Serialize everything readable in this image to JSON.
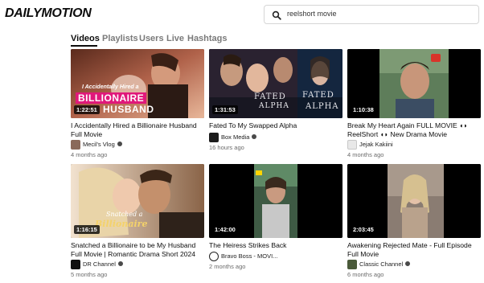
{
  "brand": {
    "logo": "DAILYMOTION"
  },
  "search": {
    "query": "reelshort movie"
  },
  "tabs": [
    {
      "label": "Videos",
      "active": true
    },
    {
      "label": "Playlists",
      "active": false
    },
    {
      "label": "Users",
      "active": false
    },
    {
      "label": "Live",
      "active": false
    },
    {
      "label": "Hashtags",
      "active": false
    }
  ],
  "videos": [
    {
      "title": "I Accidentally Hired a Billionaire Husband Full Movie",
      "duration": "1:22:51",
      "channel": "Mecil's Vlog",
      "age": "4 months ago",
      "thumb_text_1": "I Accidentally Hired a",
      "thumb_text_2": "BILLIONAIRE",
      "thumb_text_3": "HUSBAND"
    },
    {
      "title": "Fated To My Swapped Alpha",
      "duration": "1:31:53",
      "channel": "Box Media",
      "age": "16 hours ago",
      "thumb_text_1": "FATED",
      "thumb_text_2": "ALPHA"
    },
    {
      "title": "Break My Heart Again FULL MOVIE ◖◗ ReelShort ◖◗ New Drama Movie",
      "duration": "1:10:38",
      "channel": "Jejak Kakiini",
      "age": "4 months ago"
    },
    {
      "title": "Snatched a Billionaire to be My Husband Full Movie | Romantic Drama Short 2024",
      "duration": "1:16:15",
      "channel": "DR Channel",
      "age": "5 months ago",
      "thumb_text_1": "Snatched a",
      "thumb_text_2": "Billionaire"
    },
    {
      "title": "The Heiress Strikes Back",
      "duration": "1:42:00",
      "channel": "Bravo Boss - MOVI...",
      "age": "2 months ago"
    },
    {
      "title": "Awakening Rejected Mate - Full Episode Full Movie",
      "duration": "2:03:45",
      "channel": "Classic Channel",
      "age": "6 months ago"
    }
  ]
}
